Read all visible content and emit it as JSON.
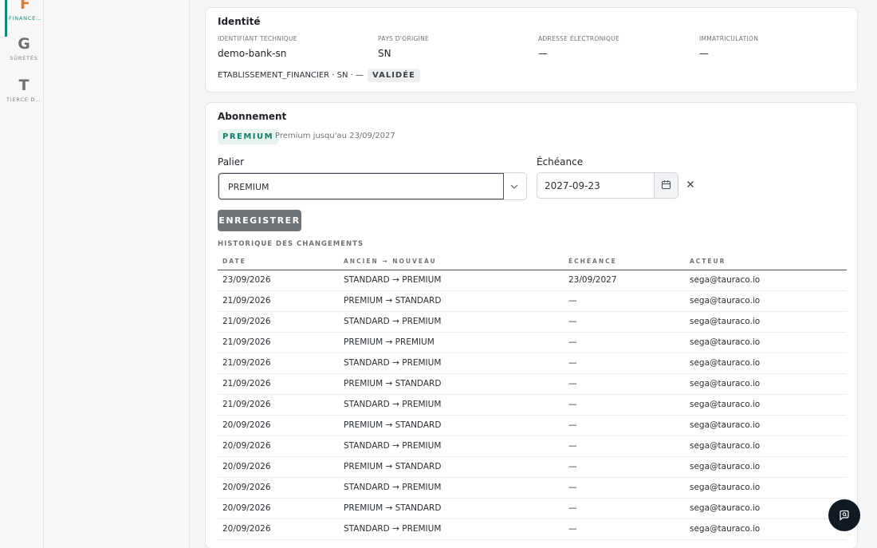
{
  "nav": {
    "items": [
      {
        "letter": "F",
        "label": "FINANCEM…"
      },
      {
        "letter": "G",
        "label": "SÛRETÉS"
      },
      {
        "letter": "T",
        "label": "TIERCE DÉ…"
      }
    ]
  },
  "identity": {
    "title": "Identité",
    "fields": [
      {
        "label": "IDENTIFIANT TECHNIQUE",
        "value": "demo-bank-sn"
      },
      {
        "label": "PAYS D'ORIGINE",
        "value": "SN"
      },
      {
        "label": "ADRESSE ÉLECTRONIQUE",
        "value": "—"
      },
      {
        "label": "IMMATRICULATION",
        "value": "—"
      }
    ],
    "meta": "ETABLISSEMENT_FINANCIER · SN · —",
    "status": "VALIDÉE"
  },
  "subscription": {
    "title": "Abonnement",
    "tier_badge": "PREMIUM",
    "tier_note": "Premium jusqu'au 23/09/2027",
    "tier_label": "Palier",
    "tier_value": "PREMIUM",
    "expiry_label": "Échéance",
    "expiry_value": "2027-09-23",
    "save_label": "ENREGISTRER",
    "history_title": "HISTORIQUE DES CHANGEMENTS",
    "history_columns": [
      "DATE",
      "ANCIEN → NOUVEAU",
      "ÉCHÉANCE",
      "ACTEUR"
    ],
    "history_rows": [
      [
        "23/09/2026",
        "STANDARD → PREMIUM",
        "23/09/2027",
        "sega@tauraco.io"
      ],
      [
        "21/09/2026",
        "PREMIUM → STANDARD",
        "—",
        "sega@tauraco.io"
      ],
      [
        "21/09/2026",
        "STANDARD → PREMIUM",
        "—",
        "sega@tauraco.io"
      ],
      [
        "21/09/2026",
        "PREMIUM → PREMIUM",
        "—",
        "sega@tauraco.io"
      ],
      [
        "21/09/2026",
        "STANDARD → PREMIUM",
        "—",
        "sega@tauraco.io"
      ],
      [
        "21/09/2026",
        "PREMIUM → STANDARD",
        "—",
        "sega@tauraco.io"
      ],
      [
        "21/09/2026",
        "STANDARD → PREMIUM",
        "—",
        "sega@tauraco.io"
      ],
      [
        "20/09/2026",
        "PREMIUM → STANDARD",
        "—",
        "sega@tauraco.io"
      ],
      [
        "20/09/2026",
        "STANDARD → PREMIUM",
        "—",
        "sega@tauraco.io"
      ],
      [
        "20/09/2026",
        "PREMIUM → STANDARD",
        "—",
        "sega@tauraco.io"
      ],
      [
        "20/09/2026",
        "STANDARD → PREMIUM",
        "—",
        "sega@tauraco.io"
      ],
      [
        "20/09/2026",
        "PREMIUM → STANDARD",
        "—",
        "sega@tauraco.io"
      ],
      [
        "20/09/2026",
        "STANDARD → PREMIUM",
        "—",
        "sega@tauraco.io"
      ]
    ]
  },
  "colors": {
    "accent": "#13887a",
    "premium_bg": "#e8f4f0",
    "button": "#6f7479",
    "fab": "#0f1a24"
  },
  "icons": {
    "tier_select": "chevron-down-icon",
    "date_picker": "calendar-icon",
    "clear": "close-icon",
    "chat": "chat-search-icon"
  }
}
